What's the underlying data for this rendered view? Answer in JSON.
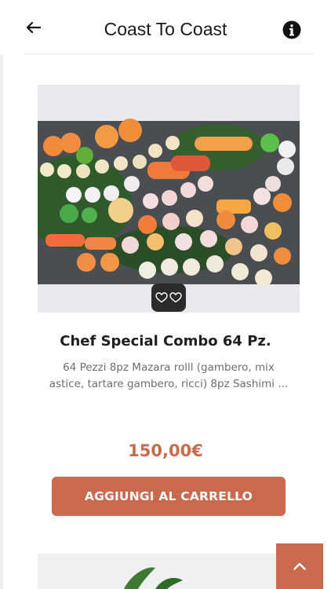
{
  "header": {
    "title": "Coast To Coast",
    "back_icon": "arrow-left-icon",
    "info_icon": "info-circle-icon"
  },
  "product": {
    "name": "Chef Special Combo 64 Pz.",
    "description": "64 Pezzi 8pz Mazara rolll (gambero, mix astice, tartare gambero, ricci) 8pz Sashimi ...",
    "price": "150,00€",
    "add_to_cart_label": "AGGIUNGI AL CARRELLO",
    "favorite_icon": "heart-outline-icon"
  },
  "colors": {
    "accent": "#c96a4f",
    "dark": "#2b2b2b"
  },
  "scroll_top_icon": "chevron-up-icon"
}
